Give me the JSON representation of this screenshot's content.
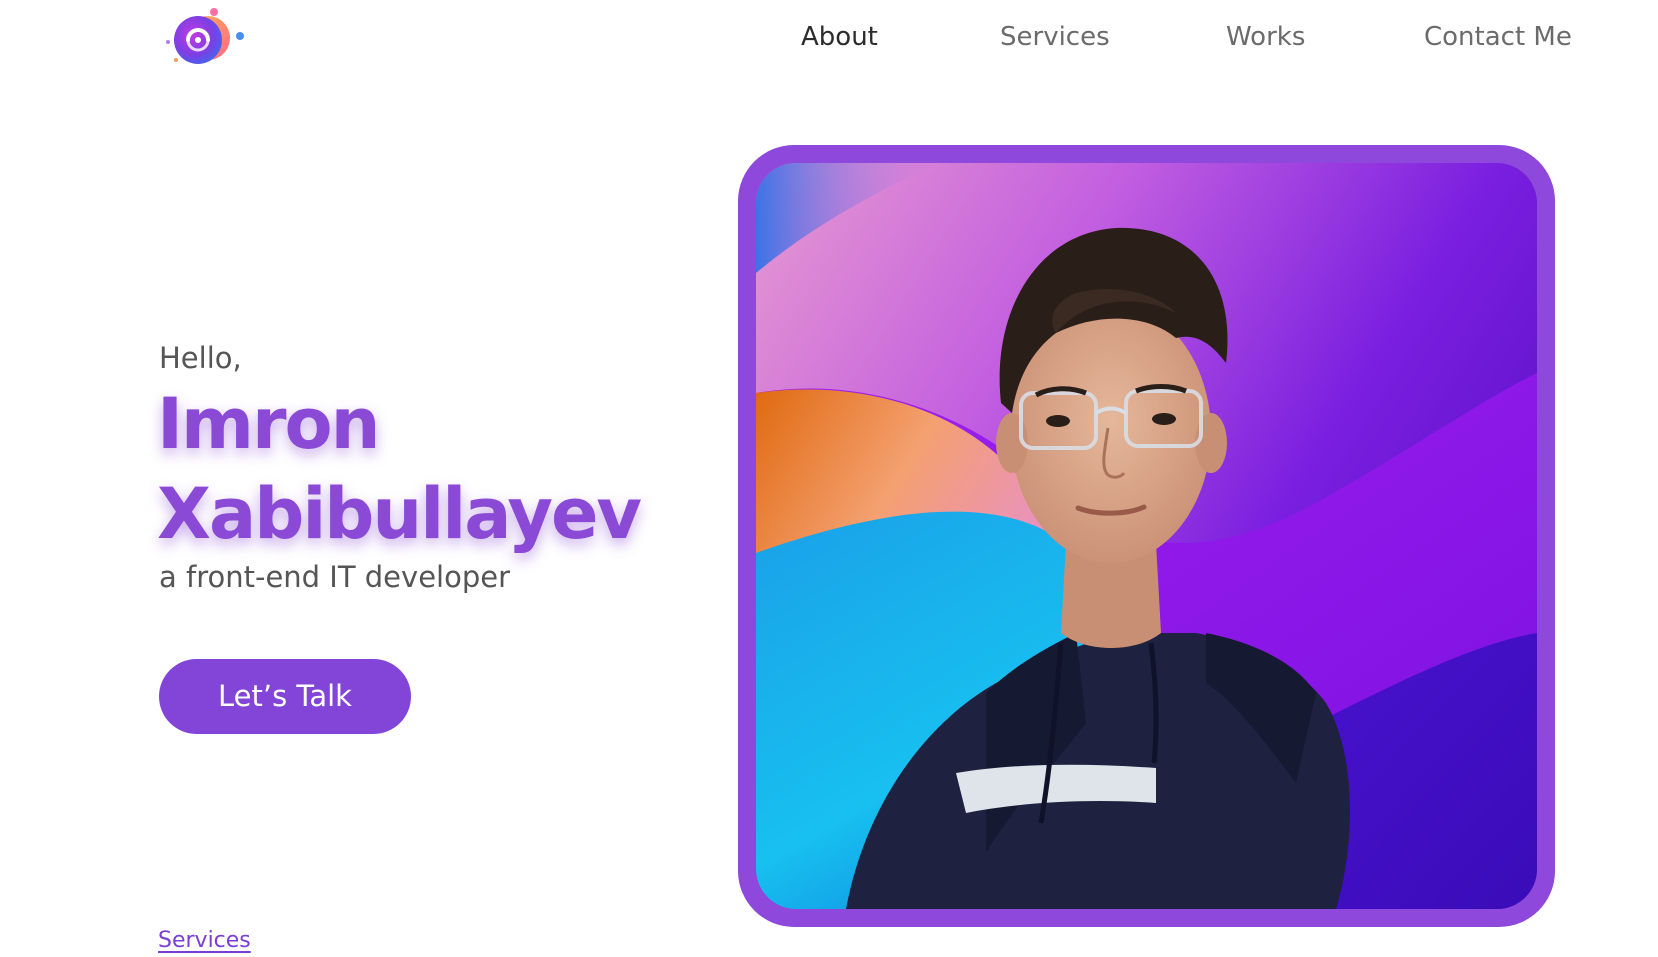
{
  "nav": {
    "items": [
      {
        "label": "About",
        "active": true
      },
      {
        "label": "Services",
        "active": false
      },
      {
        "label": "Works",
        "active": false
      },
      {
        "label": "Contact Me",
        "active": false
      }
    ]
  },
  "hero": {
    "greeting": "Hello,",
    "first_name": "Imron",
    "last_name": "Xabibullayev",
    "role": "a front-end IT developer",
    "cta_label": "Let’s Talk"
  },
  "footer_link": "Services",
  "portrait": {
    "alt": "Imron Xabibullayev"
  },
  "colors": {
    "accent": "#8245d8",
    "name": "#8a4ad6",
    "frame": "#8e48dc",
    "text": "#555555"
  }
}
